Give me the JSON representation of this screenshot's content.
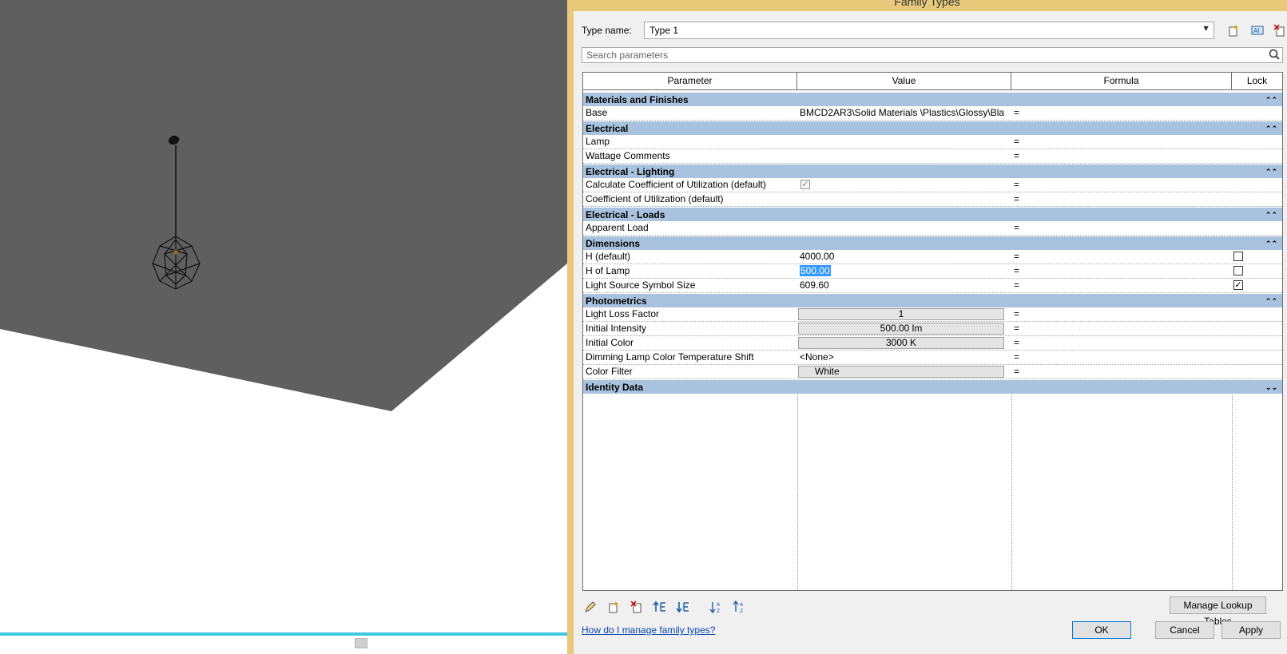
{
  "dialog": {
    "title": "Family Types",
    "type_name_label": "Type name:",
    "type_name_value": "Type 1",
    "search_placeholder": "Search parameters",
    "columns": {
      "parameter": "Parameter",
      "value": "Value",
      "formula": "Formula",
      "lock": "Lock"
    },
    "groups": [
      {
        "name": "Materials and Finishes",
        "rows": [
          {
            "param": "Base",
            "value": "BMCD2AR3\\Solid Materials \\Plastics\\Glossy\\Bla",
            "formula": "="
          }
        ]
      },
      {
        "name": "Electrical",
        "rows": [
          {
            "param": "Lamp",
            "value": "",
            "formula": "="
          },
          {
            "param": "Wattage Comments",
            "value": "",
            "formula": "="
          }
        ]
      },
      {
        "name": "Electrical - Lighting",
        "rows": [
          {
            "param": "Calculate Coefficient of Utilization (default)",
            "value": "",
            "formula": "="
          },
          {
            "param": "Coefficient of Utilization (default)",
            "value": "",
            "formula": "="
          }
        ]
      },
      {
        "name": "Electrical - Loads",
        "rows": [
          {
            "param": "Apparent Load",
            "value": "",
            "formula": "="
          }
        ]
      },
      {
        "name": "Dimensions",
        "rows": [
          {
            "param": "H (default)",
            "value": "4000.00",
            "formula": "="
          },
          {
            "param": "H of Lamp",
            "value": "500.00",
            "formula": "="
          },
          {
            "param": "Light Source Symbol Size",
            "value": "609.60",
            "formula": "="
          }
        ]
      },
      {
        "name": "Photometrics",
        "rows": [
          {
            "param": "Light Loss Factor",
            "value": "1",
            "formula": "="
          },
          {
            "param": "Initial Intensity",
            "value": "500.00 lm",
            "formula": "="
          },
          {
            "param": "Initial Color",
            "value": "3000 K",
            "formula": "="
          },
          {
            "param": "Dimming Lamp Color Temperature Shift",
            "value": "<None>",
            "formula": "="
          },
          {
            "param": "Color Filter",
            "value": "White",
            "formula": "="
          }
        ]
      },
      {
        "name": "Identity Data",
        "rows": []
      }
    ],
    "collapse_glyph": "⌃⌃",
    "expand_glyph": "⌄⌄",
    "checkmark": "✓",
    "manage_lookup_label": "Manage Lookup Tables",
    "help_link": "How do I manage family types?",
    "ok_label": "OK",
    "cancel_label": "Cancel",
    "apply_label": "Apply",
    "icons": {
      "new_type": "new-type-icon",
      "rename_type": "rename-type-icon",
      "delete_type": "delete-type-icon",
      "search": "search-icon",
      "edit_param": "pencil-icon",
      "new_param": "new-parameter-icon",
      "delete_param": "delete-parameter-icon",
      "move_up": "move-up-icon",
      "move_down": "move-down-icon",
      "sort_asc": "sort-ascending-icon",
      "sort_desc": "sort-descending-icon"
    },
    "colors": {
      "group_header": "#a9c3de",
      "selection": "#3399ff",
      "viewport_floor": "#5f5f5f",
      "accent_bar": "#3cc8e0"
    }
  }
}
